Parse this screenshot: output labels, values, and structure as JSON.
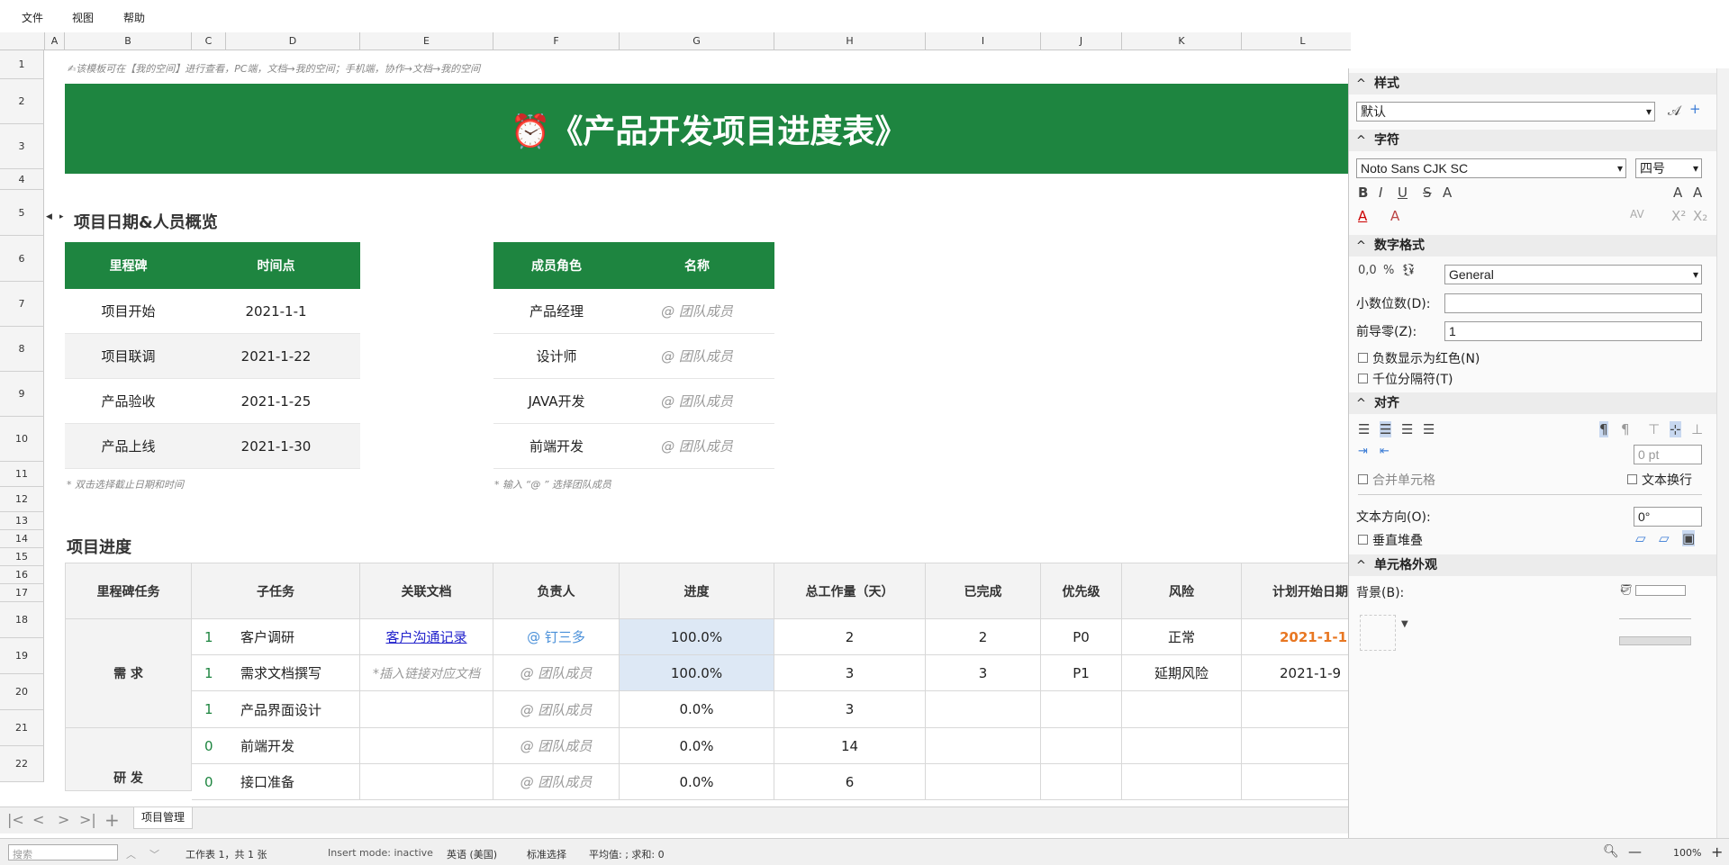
{
  "menu": [
    "文件",
    "视图",
    "帮助"
  ],
  "columns": [
    "A",
    "B",
    "C",
    "D",
    "E",
    "F",
    "G",
    "H",
    "I",
    "J",
    "K",
    "L"
  ],
  "rows": [
    "1",
    "2",
    "3",
    "4",
    "5",
    "6",
    "7",
    "8",
    "9",
    "10",
    "11",
    "12",
    "13",
    "14",
    "15",
    "16",
    "17",
    "18",
    "19",
    "20",
    "21",
    "22"
  ],
  "hint_top": "✍该模板可在【我的空间】进行查看，PC端，文档→我的空间；手机端，协作→文档→我的空间",
  "banner_title": "⏰《产品开发项目进度表》",
  "section1_title": "项目日期&人员概览",
  "milestones": {
    "headers": [
      "里程碑",
      "时间点"
    ],
    "rows": [
      [
        "项目开始",
        "2021-1-1"
      ],
      [
        "项目联调",
        "2021-1-22"
      ],
      [
        "产品验收",
        "2021-1-25"
      ],
      [
        "产品上线",
        "2021-1-30"
      ]
    ],
    "note": "* 双击选择截止日期和时间"
  },
  "members": {
    "headers": [
      "成员角色",
      "名称"
    ],
    "rows": [
      [
        "产品经理",
        "@ 团队成员"
      ],
      [
        "设计师",
        "@ 团队成员"
      ],
      [
        "JAVA开发",
        "@ 团队成员"
      ],
      [
        "前端开发",
        "@ 团队成员"
      ]
    ],
    "note": "* 输入 “@ ” 选择团队成员"
  },
  "section2_title": "项目进度",
  "progress": {
    "headers": [
      "里程碑任务",
      "子任务",
      "关联文档",
      "负责人",
      "进度",
      "总工作量（天）",
      "已完成",
      "优先级",
      "风险",
      "计划开始日期"
    ],
    "group1": "需 求",
    "group2": "研 发",
    "rows": [
      {
        "flag": "1",
        "task": "客户调研",
        "doc": "客户沟通记录",
        "owner": "@ 钉三多",
        "progress": "100.0%",
        "total": "2",
        "done": "2",
        "priority": "P0",
        "risk": "正常",
        "start": "2021-1-1"
      },
      {
        "flag": "1",
        "task": "需求文档撰写",
        "doc": "*插入链接对应文档",
        "owner": "@ 团队成员",
        "progress": "100.0%",
        "total": "3",
        "done": "3",
        "priority": "P1",
        "risk": "延期风险",
        "start": "2021-1-9"
      },
      {
        "flag": "1",
        "task": "产品界面设计",
        "doc": "",
        "owner": "@ 团队成员",
        "progress": "0.0%",
        "total": "3",
        "done": "",
        "priority": "",
        "risk": "",
        "start": ""
      },
      {
        "flag": "0",
        "task": "前端开发",
        "doc": "",
        "owner": "@ 团队成员",
        "progress": "0.0%",
        "total": "14",
        "done": "",
        "priority": "",
        "risk": "",
        "start": ""
      },
      {
        "flag": "0",
        "task": "接口准备",
        "doc": "",
        "owner": "@ 团队成员",
        "progress": "0.0%",
        "total": "6",
        "done": "",
        "priority": "",
        "risk": "",
        "start": ""
      }
    ]
  },
  "sheet_tab": "项目管理",
  "status": {
    "search_placeholder": "搜索",
    "sheet_info": "工作表 1，共 1 张",
    "insert_mode": "Insert mode: inactive",
    "language": "英语 (美国)",
    "selection_mode": "标准选择",
    "summary": "平均值: ; 求和: 0",
    "zoom": "100%"
  },
  "sidebar": {
    "style_title": "样式",
    "style_value": "默认",
    "char_title": "字符",
    "font_name": "Noto Sans CJK SC",
    "font_size": "四号",
    "number_title": "数字格式",
    "number_format": "General",
    "decimals_label": "小数位数(D):",
    "decimals_value": "",
    "leading_label": "前导零(Z):",
    "leading_value": "1",
    "neg_red_label": "负数显示为红色(N)",
    "thousands_label": "千位分隔符(T)",
    "align_title": "对齐",
    "indent_value": "0 pt",
    "merge_label": "合并单元格",
    "wrap_label": "文本换行",
    "direction_label": "文本方向(O):",
    "direction_value": "0°",
    "vertical_label": "垂直堆叠",
    "appearance_title": "单元格外观",
    "bg_label": "背景(B):"
  },
  "colors": {
    "green": "#1e8540",
    "orange": "#e87722",
    "progress_fill": "#dde8f5",
    "link": "#2222cc",
    "owner_blue": "#4a90d9"
  }
}
